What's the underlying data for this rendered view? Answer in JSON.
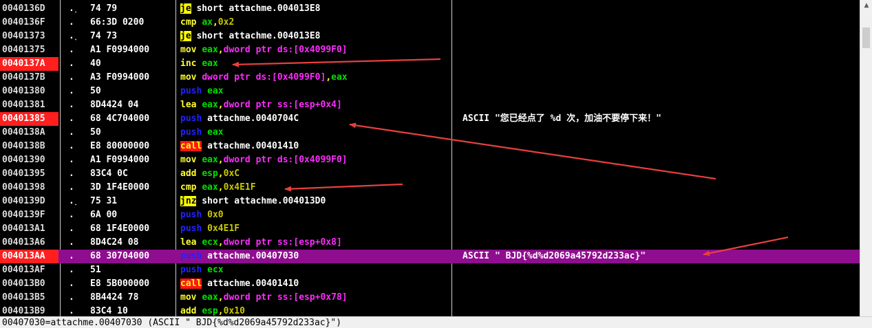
{
  "colors": {
    "background": "#000000",
    "selected_row": "#8f0d8f",
    "highlight_address": "#ff1f1f",
    "annotation_arrow": "#e84040"
  },
  "rows": [
    {
      "addr": "0040136D",
      "mark": ".˯",
      "hex": "74 79",
      "disasm": [
        {
          "t": "je",
          "c": "jcc"
        },
        {
          "t": " short attachme.004013E8",
          "c": "wht"
        }
      ],
      "comment": ""
    },
    {
      "addr": "0040136F",
      "mark": ".",
      "hex": "66:3D 0200",
      "disasm": [
        {
          "t": "cmp ",
          "c": "ylw"
        },
        {
          "t": "ax",
          "c": "grn"
        },
        {
          "t": ",",
          "c": "ylw"
        },
        {
          "t": "0x2",
          "c": "olv"
        }
      ],
      "comment": ""
    },
    {
      "addr": "00401373",
      "mark": ".˯",
      "hex": "74 73",
      "disasm": [
        {
          "t": "je",
          "c": "jcc"
        },
        {
          "t": " short attachme.004013E8",
          "c": "wht"
        }
      ],
      "comment": ""
    },
    {
      "addr": "00401375",
      "mark": ".",
      "hex": "A1 F0994000",
      "disasm": [
        {
          "t": "mov ",
          "c": "ylw"
        },
        {
          "t": "eax",
          "c": "grn"
        },
        {
          "t": ",",
          "c": "ylw"
        },
        {
          "t": "dword ptr ds:[0x4099F0]",
          "c": "mag"
        }
      ],
      "comment": ""
    },
    {
      "addr": "0040137A",
      "mark": ".",
      "hex": "40",
      "disasm": [
        {
          "t": "inc ",
          "c": "ylw"
        },
        {
          "t": "eax",
          "c": "grn"
        }
      ],
      "comment": "",
      "addr_highlight": true
    },
    {
      "addr": "0040137B",
      "mark": ".",
      "hex": "A3 F0994000",
      "disasm": [
        {
          "t": "mov ",
          "c": "ylw"
        },
        {
          "t": "dword ptr ds:[0x4099F0]",
          "c": "mag"
        },
        {
          "t": ",",
          "c": "ylw"
        },
        {
          "t": "eax",
          "c": "grn"
        }
      ],
      "comment": ""
    },
    {
      "addr": "00401380",
      "mark": ".",
      "hex": "50",
      "disasm": [
        {
          "t": "push ",
          "c": "blu"
        },
        {
          "t": "eax",
          "c": "grn"
        }
      ],
      "comment": ""
    },
    {
      "addr": "00401381",
      "mark": ".",
      "hex": "8D4424 04",
      "disasm": [
        {
          "t": "lea ",
          "c": "ylw"
        },
        {
          "t": "eax",
          "c": "grn"
        },
        {
          "t": ",",
          "c": "ylw"
        },
        {
          "t": "dword ptr ss:[esp+0x4]",
          "c": "mag"
        }
      ],
      "comment": ""
    },
    {
      "addr": "00401385",
      "mark": ".",
      "hex": "68 4C704000",
      "disasm": [
        {
          "t": "push ",
          "c": "blu"
        },
        {
          "t": "attachme.0040704C",
          "c": "wht"
        }
      ],
      "comment": "ASCII \"您已经点了 %d 次，加油不要停下来！\"",
      "addr_highlight": true
    },
    {
      "addr": "0040138A",
      "mark": ".",
      "hex": "50",
      "disasm": [
        {
          "t": "push ",
          "c": "blu"
        },
        {
          "t": "eax",
          "c": "grn"
        }
      ],
      "comment": ""
    },
    {
      "addr": "0040138B",
      "mark": ".",
      "hex": "E8 80000000",
      "disasm": [
        {
          "t": "call",
          "c": "call"
        },
        {
          "t": " attachme.00401410",
          "c": "wht"
        }
      ],
      "comment": ""
    },
    {
      "addr": "00401390",
      "mark": ".",
      "hex": "A1 F0994000",
      "disasm": [
        {
          "t": "mov ",
          "c": "ylw"
        },
        {
          "t": "eax",
          "c": "grn"
        },
        {
          "t": ",",
          "c": "ylw"
        },
        {
          "t": "dword ptr ds:[0x4099F0]",
          "c": "mag"
        }
      ],
      "comment": ""
    },
    {
      "addr": "00401395",
      "mark": ".",
      "hex": "83C4 0C",
      "disasm": [
        {
          "t": "add ",
          "c": "ylw"
        },
        {
          "t": "esp",
          "c": "grn"
        },
        {
          "t": ",",
          "c": "ylw"
        },
        {
          "t": "0xC",
          "c": "olv"
        }
      ],
      "comment": ""
    },
    {
      "addr": "00401398",
      "mark": ".",
      "hex": "3D 1F4E0000",
      "disasm": [
        {
          "t": "cmp ",
          "c": "ylw"
        },
        {
          "t": "eax",
          "c": "grn"
        },
        {
          "t": ",",
          "c": "ylw"
        },
        {
          "t": "0x4E1F",
          "c": "olv"
        }
      ],
      "comment": ""
    },
    {
      "addr": "0040139D",
      "mark": ".˯",
      "hex": "75 31",
      "disasm": [
        {
          "t": "jnz",
          "c": "jcc"
        },
        {
          "t": " short attachme.004013D0",
          "c": "wht"
        }
      ],
      "comment": ""
    },
    {
      "addr": "0040139F",
      "mark": ".",
      "hex": "6A 00",
      "disasm": [
        {
          "t": "push ",
          "c": "blu"
        },
        {
          "t": "0x0",
          "c": "olv"
        }
      ],
      "comment": ""
    },
    {
      "addr": "004013A1",
      "mark": ".",
      "hex": "68 1F4E0000",
      "disasm": [
        {
          "t": "push ",
          "c": "blu"
        },
        {
          "t": "0x4E1F",
          "c": "olv"
        }
      ],
      "comment": ""
    },
    {
      "addr": "004013A6",
      "mark": ".",
      "hex": "8D4C24 08",
      "disasm": [
        {
          "t": "lea ",
          "c": "ylw"
        },
        {
          "t": "ecx",
          "c": "grn"
        },
        {
          "t": ",",
          "c": "ylw"
        },
        {
          "t": "dword ptr ss:[esp+0x8]",
          "c": "mag"
        }
      ],
      "comment": ""
    },
    {
      "addr": "004013AA",
      "mark": ".",
      "hex": "68 30704000",
      "disasm": [
        {
          "t": "push ",
          "c": "blu"
        },
        {
          "t": "attachme.00407030",
          "c": "wht"
        }
      ],
      "comment": "ASCII \" BJD{%d%d2069a45792d233ac}\"",
      "addr_highlight": true,
      "selected": true
    },
    {
      "addr": "004013AF",
      "mark": ".",
      "hex": "51",
      "disasm": [
        {
          "t": "push ",
          "c": "blu"
        },
        {
          "t": "ecx",
          "c": "grn"
        }
      ],
      "comment": ""
    },
    {
      "addr": "004013B0",
      "mark": ".",
      "hex": "E8 5B000000",
      "disasm": [
        {
          "t": "call",
          "c": "call"
        },
        {
          "t": " attachme.00401410",
          "c": "wht"
        }
      ],
      "comment": ""
    },
    {
      "addr": "004013B5",
      "mark": ".",
      "hex": "8B4424 78",
      "disasm": [
        {
          "t": "mov ",
          "c": "ylw"
        },
        {
          "t": "eax",
          "c": "grn"
        },
        {
          "t": ",",
          "c": "ylw"
        },
        {
          "t": "dword ptr ss:[esp+0x78]",
          "c": "mag"
        }
      ],
      "comment": ""
    },
    {
      "addr": "004013B9",
      "mark": ".",
      "hex": "83C4 10",
      "disasm": [
        {
          "t": "add ",
          "c": "ylw"
        },
        {
          "t": "esp",
          "c": "grn"
        },
        {
          "t": ",",
          "c": "ylw"
        },
        {
          "t": "0x10",
          "c": "olv"
        }
      ],
      "comment": ""
    }
  ],
  "status": {
    "text": "00407030=attachme.00407030 (ASCII \" BJD{%d%d2069a45792d233ac}\")"
  },
  "icons": {
    "scroll_up": "scroll-up-arrow-icon"
  }
}
